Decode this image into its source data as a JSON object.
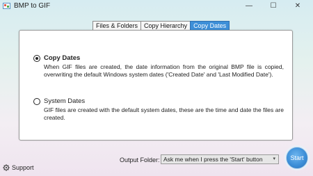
{
  "window": {
    "title": "BMP to GIF",
    "minimize_glyph": "—",
    "maximize_glyph": "☐",
    "close_glyph": "✕"
  },
  "tabs": [
    {
      "label": "Files & Folders",
      "active": false
    },
    {
      "label": "Copy Hierarchy",
      "active": false
    },
    {
      "label": "Copy Dates",
      "active": true
    }
  ],
  "options": [
    {
      "title": "Copy Dates",
      "selected": true,
      "description": "When GIF files are created, the date information from the original BMP file is copied, overwriting the default Windows system dates ('Created Date' and 'Last Modified Date')."
    },
    {
      "title": "System Dates",
      "selected": false,
      "description": "GIF files are created with the default system dates, these are the time and date the files are created."
    }
  ],
  "footer": {
    "support_label": "Support",
    "output_folder_label": "Output Folder:",
    "output_folder_value": "Ask me when I press the 'Start' button",
    "start_label": "Start"
  },
  "colors": {
    "accent": "#3d8fd8",
    "start_button": "#3d8fd8"
  },
  "icons": {
    "app": "app-icon",
    "support": "gear-icon",
    "dropdown": "chevron-down-icon"
  }
}
